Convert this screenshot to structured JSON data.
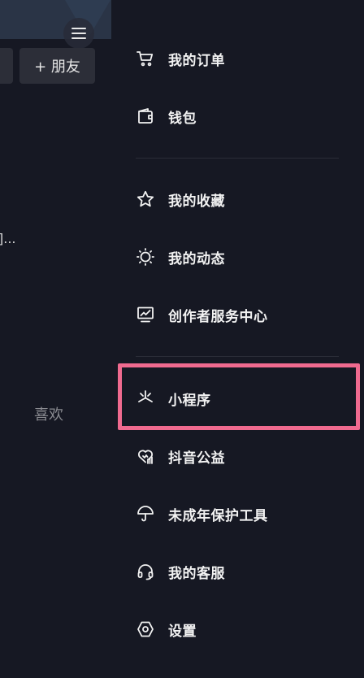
{
  "left": {
    "add_friend_label": "+ 朋友",
    "truncated_text": "]...",
    "likes_tab_label": "喜欢",
    "menu_icon": "hamburger-icon"
  },
  "drawer": {
    "items": [
      {
        "label": "我的订单",
        "icon": "cart-icon"
      },
      {
        "label": "钱包",
        "icon": "wallet-icon"
      },
      {
        "label": "我的收藏",
        "icon": "star-icon"
      },
      {
        "label": "我的动态",
        "icon": "sun-icon"
      },
      {
        "label": "创作者服务中心",
        "icon": "chart-monitor-icon"
      },
      {
        "label": "小程序",
        "icon": "asterisk-icon"
      },
      {
        "label": "抖音公益",
        "icon": "heart-hand-icon"
      },
      {
        "label": "未成年保护工具",
        "icon": "umbrella-icon"
      },
      {
        "label": "我的客服",
        "icon": "headset-icon"
      },
      {
        "label": "设置",
        "icon": "hexagon-gear-icon"
      }
    ]
  },
  "colors": {
    "background": "#161823",
    "text": "#f2f2f2",
    "highlight": "#f06a8f",
    "muted": "#8a8b91"
  }
}
